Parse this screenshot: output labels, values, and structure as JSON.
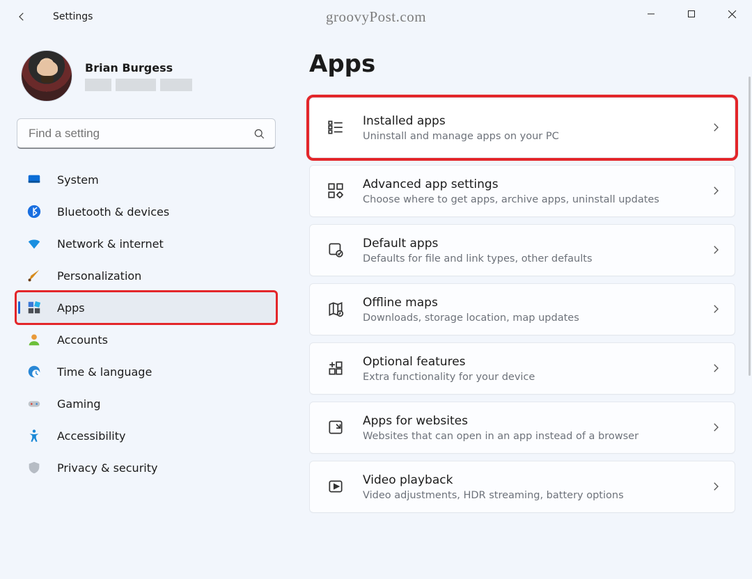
{
  "titlebar": {
    "title": "Settings",
    "watermark": "groovyPost.com"
  },
  "profile": {
    "name": "Brian Burgess"
  },
  "search": {
    "placeholder": "Find a setting"
  },
  "sidebar": {
    "items": [
      {
        "label": "System",
        "icon": "system"
      },
      {
        "label": "Bluetooth & devices",
        "icon": "bluetooth"
      },
      {
        "label": "Network & internet",
        "icon": "wifi"
      },
      {
        "label": "Personalization",
        "icon": "brush"
      },
      {
        "label": "Apps",
        "icon": "apps",
        "active": true,
        "highlight": true
      },
      {
        "label": "Accounts",
        "icon": "account"
      },
      {
        "label": "Time & language",
        "icon": "clock"
      },
      {
        "label": "Gaming",
        "icon": "gaming"
      },
      {
        "label": "Accessibility",
        "icon": "accessibility"
      },
      {
        "label": "Privacy & security",
        "icon": "shield"
      }
    ]
  },
  "main": {
    "heading": "Apps",
    "cards": [
      {
        "title": "Installed apps",
        "subtitle": "Uninstall and manage apps on your PC",
        "icon": "installed",
        "highlight": true
      },
      {
        "title": "Advanced app settings",
        "subtitle": "Choose where to get apps, archive apps, uninstall updates",
        "icon": "advanced"
      },
      {
        "title": "Default apps",
        "subtitle": "Defaults for file and link types, other defaults",
        "icon": "default"
      },
      {
        "title": "Offline maps",
        "subtitle": "Downloads, storage location, map updates",
        "icon": "maps"
      },
      {
        "title": "Optional features",
        "subtitle": "Extra functionality for your device",
        "icon": "optional"
      },
      {
        "title": "Apps for websites",
        "subtitle": "Websites that can open in an app instead of a browser",
        "icon": "websites"
      },
      {
        "title": "Video playback",
        "subtitle": "Video adjustments, HDR streaming, battery options",
        "icon": "video"
      }
    ]
  }
}
